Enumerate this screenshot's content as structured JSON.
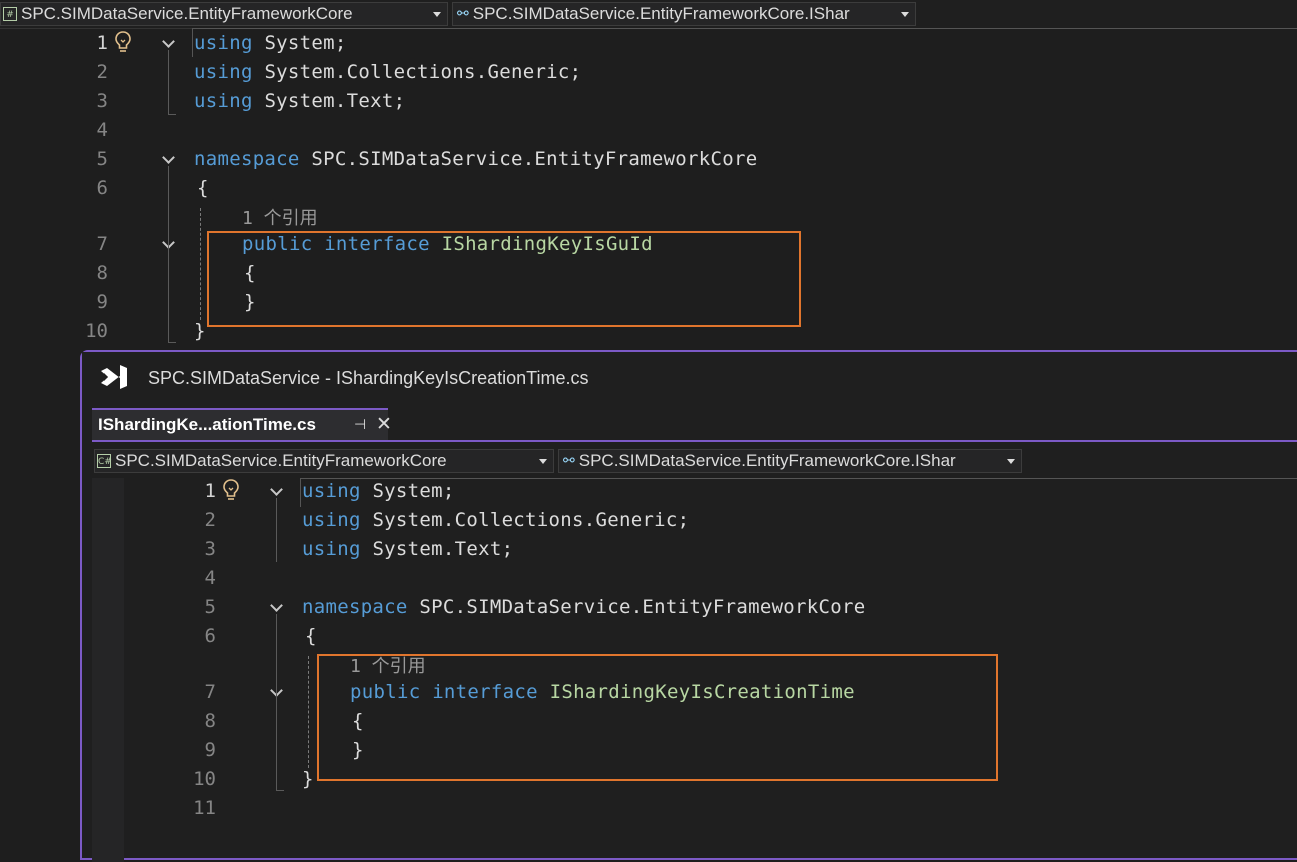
{
  "top": {
    "nav": {
      "project": "SPC.SIMDataService.EntityFrameworkCore",
      "type": "SPC.SIMDataService.EntityFrameworkCore.IShar"
    },
    "lines": [
      "1",
      "2",
      "3",
      "4",
      "5",
      "6",
      "7",
      "8",
      "9",
      "10"
    ],
    "kw_using": "using",
    "kw_namespace": "namespace",
    "kw_public": "public",
    "kw_interface": "interface",
    "ns1": " System;",
    "ns2": " System.Collections.Generic;",
    "ns3": " System.Text;",
    "namespace_name": " SPC.SIMDataService.EntityFrameworkCore",
    "open_brace": "{",
    "close_brace": "}",
    "ref_count": "1 个引用",
    "interface_name": "IShardingKeyIsGuId"
  },
  "window": {
    "title": "SPC.SIMDataService - IShardingKeyIsCreationTime.cs",
    "tab_label": "IShardingKe...ationTime.cs",
    "pin_glyph": "⊣",
    "close_glyph": "✕",
    "nav": {
      "project": "SPC.SIMDataService.EntityFrameworkCore",
      "type": "SPC.SIMDataService.EntityFrameworkCore.IShar"
    },
    "lines": [
      "1",
      "2",
      "3",
      "4",
      "5",
      "6",
      "7",
      "8",
      "9",
      "10",
      "11"
    ],
    "ref_count": "1 个引用",
    "interface_name": "IShardingKeyIsCreationTime"
  },
  "colors": {
    "keyword": "#569cd6",
    "type": "#b8d7a3",
    "highlight_box": "#e0752d",
    "window_border": "#7c5ac6"
  },
  "icons": [
    "csharp-file-icon",
    "member-link-icon",
    "lightbulb-icon",
    "visual-studio-logo-icon",
    "pin-icon",
    "close-icon",
    "fold-chevron-icon"
  ]
}
